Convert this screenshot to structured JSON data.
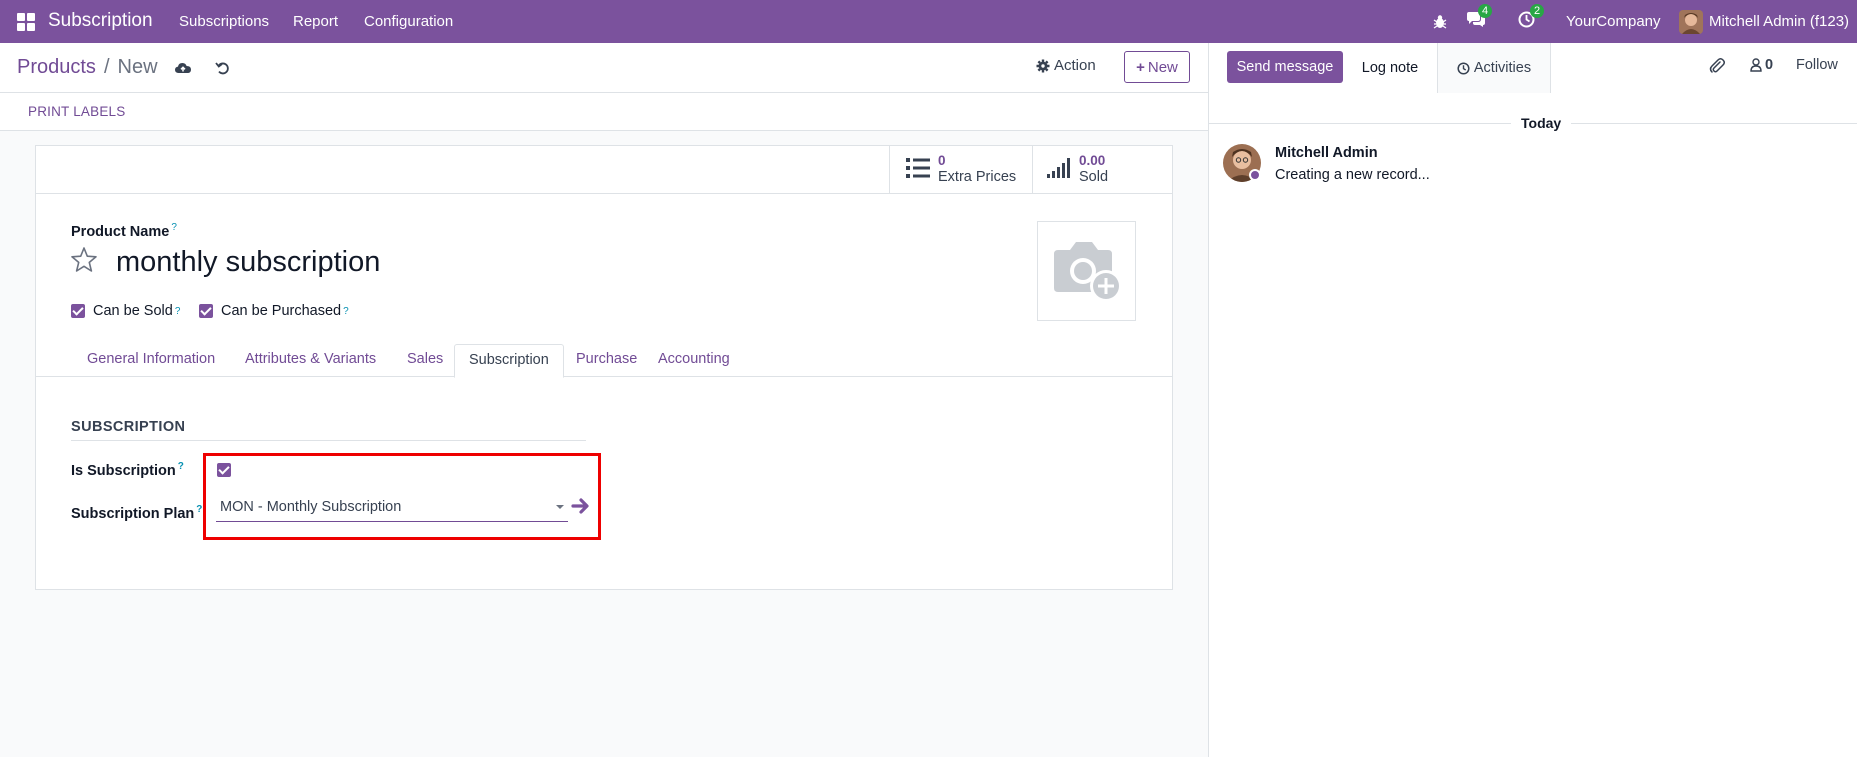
{
  "navbar": {
    "app_name": "Subscription",
    "menus": [
      "Subscriptions",
      "Report",
      "Configuration"
    ],
    "messages_count": "4",
    "activities_count": "2",
    "company": "YourCompany",
    "user": "Mitchell Admin (f123)"
  },
  "control_panel": {
    "breadcrumb_parent": "Products",
    "breadcrumb_sep": "/",
    "breadcrumb_current": "New",
    "action_label": "Action",
    "new_label": "New"
  },
  "button_bar": {
    "print_labels": "PRINT LABELS"
  },
  "smart_buttons": [
    {
      "value": "0",
      "label": "Extra Prices",
      "icon": "list-icon"
    },
    {
      "value": "0.00",
      "label": "Sold",
      "icon": "signal-bars-icon"
    }
  ],
  "form": {
    "product_name_label": "Product Name",
    "help_mark": "?",
    "product_name": "monthly subscription",
    "can_be_sold_label": "Can be Sold",
    "can_be_sold": true,
    "can_be_purchased_label": "Can be Purchased",
    "can_be_purchased": true,
    "tabs": [
      "General Information",
      "Attributes & Variants",
      "Sales",
      "Subscription",
      "Purchase",
      "Accounting"
    ],
    "active_tab": "Subscription",
    "section_title": "SUBSCRIPTION",
    "is_subscription_label": "Is Subscription",
    "is_subscription": true,
    "subscription_plan_label": "Subscription Plan",
    "subscription_plan_value": "MON - Monthly Subscription"
  },
  "chatter": {
    "send_message": "Send message",
    "log_note": "Log note",
    "activities": "Activities",
    "followers_count": "0",
    "follow": "Follow",
    "today": "Today",
    "message_author": "Mitchell Admin",
    "message_body": "Creating a new record..."
  },
  "colors": {
    "brand": "#7b529d",
    "link": "#714b95",
    "badge": "#28a745",
    "highlight": "#ee0000"
  }
}
